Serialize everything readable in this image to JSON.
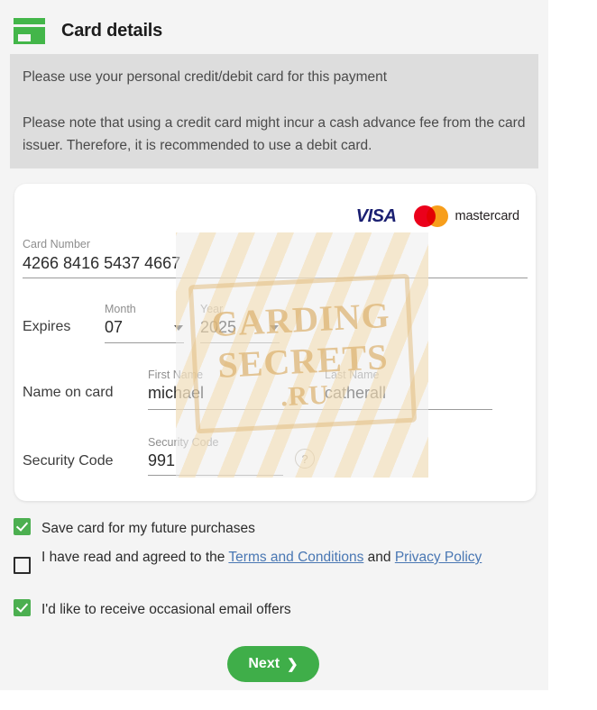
{
  "header": {
    "title": "Card details",
    "icon": "credit-card-icon"
  },
  "notices": [
    "Please use your personal credit/debit card for this payment",
    "Please note that using a credit card might incur a cash advance fee from the card issuer. Therefore, it is recommended to use a debit card."
  ],
  "brands": {
    "visa_label": "VISA",
    "mastercard_label": "mastercard",
    "mastercard_red": "#EB001B",
    "mastercard_orange": "#F79E1B",
    "visa_color": "#1A1F71"
  },
  "form": {
    "card_number": {
      "label": "Card Number",
      "value": "4266 8416 5437 4667"
    },
    "expires": {
      "row_label": "Expires",
      "month": {
        "label": "Month",
        "value": "07"
      },
      "year": {
        "label": "Year",
        "value": "2025"
      }
    },
    "name_on_card": {
      "row_label": "Name on card",
      "first": {
        "label": "First Name",
        "value": "michael"
      },
      "last": {
        "label": "Last Name",
        "value": "catherall"
      }
    },
    "security_code": {
      "row_label": "Security Code",
      "label": "Security Code",
      "value": "991",
      "help_glyph": "?"
    }
  },
  "watermark": {
    "line1": "CARDING",
    "line2": "SECRETS",
    "line3": ".RU",
    "color": "#DBB06E"
  },
  "checkboxes": [
    {
      "label": "Save card for my future purchases",
      "checked": true,
      "name": "save-card-checkbox"
    },
    {
      "text_before": "I have read and agreed to the ",
      "link1": "Terms and Conditions",
      "text_middle": " and ",
      "link2": "Privacy Policy",
      "checked": false,
      "name": "terms-checkbox"
    },
    {
      "label": "I'd like to receive occasional email offers",
      "checked": true,
      "name": "email-offers-checkbox"
    }
  ],
  "next_button": {
    "label": "Next",
    "chevron": "❯",
    "color": "#3FAE49"
  }
}
